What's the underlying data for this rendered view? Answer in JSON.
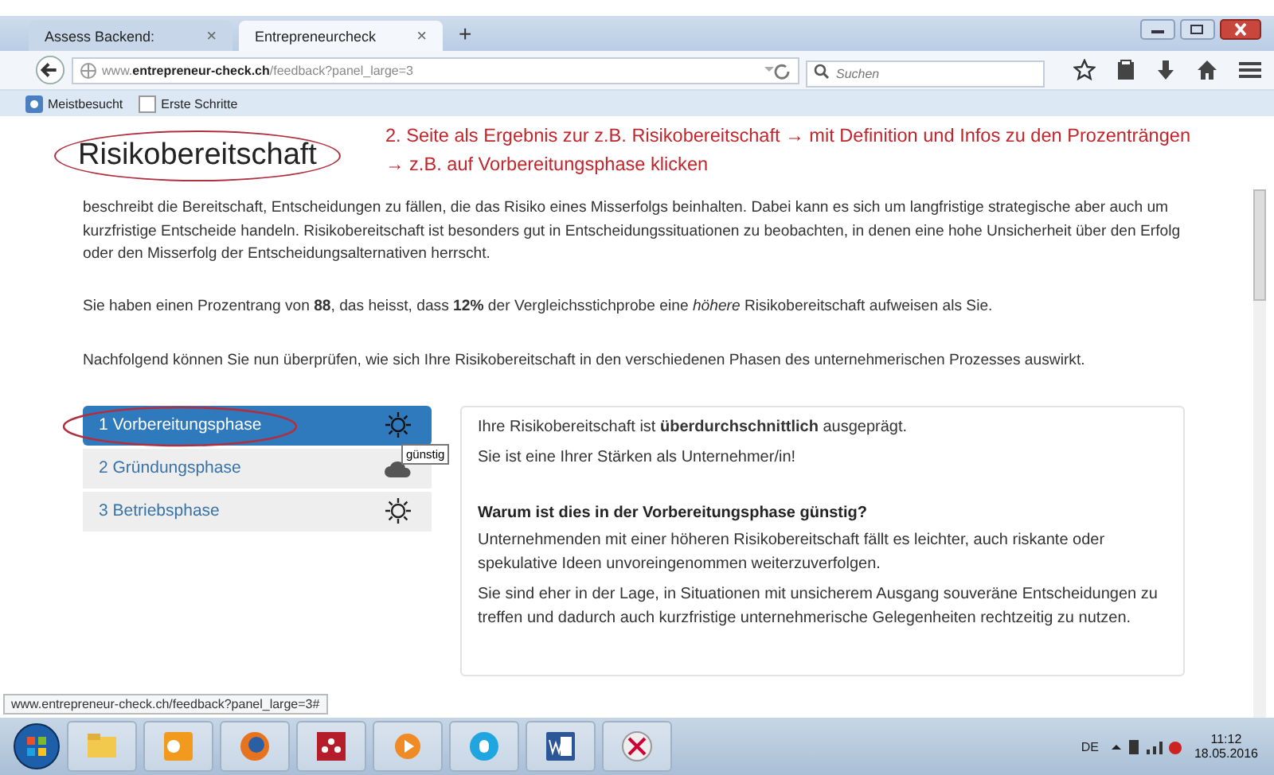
{
  "browser": {
    "tabs": [
      {
        "label": "Assess Backend:",
        "close": "×",
        "selected": false
      },
      {
        "label": "Entrepreneurcheck",
        "close": "×",
        "selected": true
      }
    ],
    "new_tab": "+",
    "url": {
      "host_pre": "www.",
      "host": "entrepreneur-check.ch",
      "path": "/feedback?panel_large=3"
    },
    "search": {
      "placeholder": "Suchen"
    },
    "bookmarks": [
      {
        "label": "Meistbesucht",
        "kind": "star"
      },
      {
        "label": "Erste Schritte",
        "kind": "page"
      }
    ]
  },
  "annotation": {
    "text": "2. Seite als Ergebnis zur z.B. Risikobereitschaft → mit Definition und Infos zu den Prozenträngen → z.B. auf Vorbereitungsphase klicken"
  },
  "page": {
    "title": "Risikobereitschaft",
    "paragraphs": [
      "beschreibt die Bereitschaft, Entscheidungen zu fällen, die das Risiko eines Misserfolgs beinhalten. Dabei kann es sich um langfristige strategische aber auch um kurzfristige Entscheide handeln. Risikobereitschaft ist besonders gut in Entscheidungssituationen zu beobachten, in denen eine hohe Unsicherheit über den Erfolg oder den Misserfolg der Entscheidungsalternativen herrscht.",
      "Sie haben einen Prozentrang von **88**, das heisst, dass **12%** der Vergleichsstichprobe eine *höhere* Risikobereitschaft aufweisen als Sie.",
      "Nachfolgend können Sie nun überprüfen, wie sich Ihre Risikobereitschaft in den verschiedenen Phasen des unternehmerischen Prozesses auswirkt."
    ],
    "phases": [
      {
        "label": "1 Vorbereitungsphase",
        "kind": "sun",
        "selected": true
      },
      {
        "label": "2 Gründungsphase",
        "kind": "cloud",
        "selected": false
      },
      {
        "label": "3 Betriebsphase",
        "kind": "sun",
        "selected": false
      }
    ],
    "tooltip": "günstig",
    "detail": {
      "lines": [
        "Ihre Risikobereitschaft ist **überdurchschnittlich** ausgeprägt.",
        "Sie ist eine Ihrer Stärken als Unternehmer/in!"
      ],
      "heading": "Warum ist dies in der Vorbereitungsphase günstig?",
      "body": [
        "Unternehmenden mit einer höheren Risikobereitschaft fällt es leichter, auch riskante oder spekulative Ideen unvoreingenommen weiterzuverfolgen.",
        "Sie sind eher in der Lage, in Situationen mit unsicherem Ausgang souveräne Entscheidungen zu treffen und dadurch auch kurzfristige unternehmerische Gelegenheiten rechtzeitig zu nutzen."
      ]
    },
    "status_url": "www.entrepreneur-check.ch/feedback?panel_large=3#"
  },
  "taskbar": {
    "apps": [
      {
        "kind": "explorer"
      },
      {
        "kind": "outlook"
      },
      {
        "kind": "firefox"
      },
      {
        "kind": "mendeley"
      },
      {
        "kind": "media"
      },
      {
        "kind": "skype"
      },
      {
        "kind": "word"
      },
      {
        "kind": "snipping"
      }
    ],
    "language": "DE",
    "time": "11:12",
    "date": "18.05.2016"
  }
}
